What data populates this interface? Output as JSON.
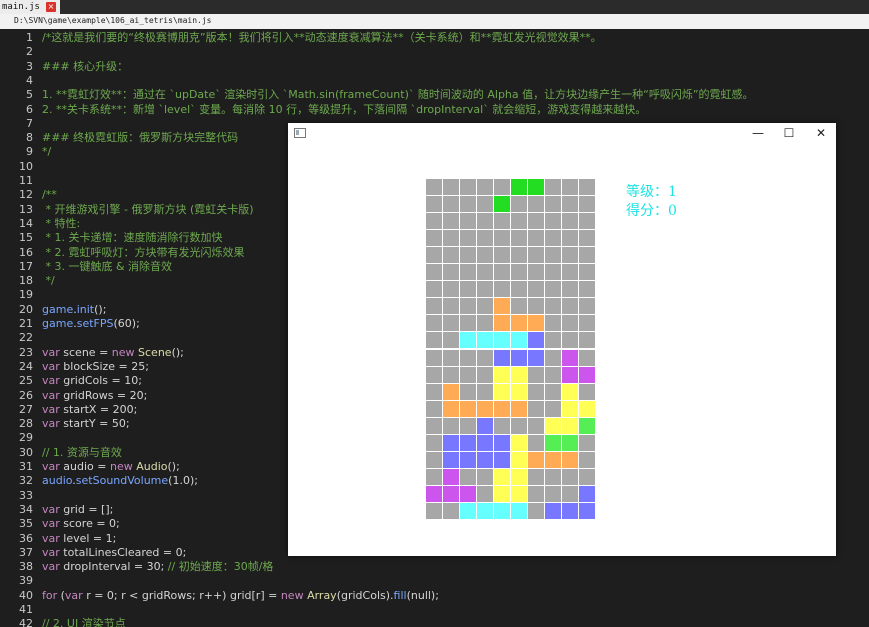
{
  "tab": {
    "filename": "main.js",
    "close_glyph": "×"
  },
  "path": "D:\\SVN\\game\\example\\106_ai_tetris\\main.js",
  "editor": {
    "lines": [
      {
        "n": "1",
        "segs": [
          {
            "t": "/*这就是我们要的“终极赛博朋克”版本！我们将引入**动态速度衰减算法**（关卡系统）和**霓虹发光视觉效果**。",
            "c": "comment"
          }
        ]
      },
      {
        "n": "2",
        "segs": []
      },
      {
        "n": "3",
        "segs": [
          {
            "t": "### 核心升级：",
            "c": "comment"
          }
        ]
      },
      {
        "n": "4",
        "segs": []
      },
      {
        "n": "5",
        "segs": [
          {
            "t": "1. **霓虹灯效**：通过在 `upDate` 渲染时引入 `Math.sin(frameCount)` 随时间波动的 Alpha 值，让方块边缘产生一种“呼吸闪烁”的霓虹感。",
            "c": "comment"
          }
        ]
      },
      {
        "n": "6",
        "segs": [
          {
            "t": "2. **关卡系统**：新增 `level` 变量。每消除 10 行，等级提升，下落间隔 `dropInterval` 就会缩短，游戏变得越来越快。",
            "c": "comment"
          }
        ]
      },
      {
        "n": "7",
        "segs": []
      },
      {
        "n": "8",
        "segs": [
          {
            "t": "### 终极霓虹版：俄罗斯方块完整代码",
            "c": "comment"
          }
        ]
      },
      {
        "n": "9",
        "segs": [
          {
            "t": "*/",
            "c": "comment"
          }
        ]
      },
      {
        "n": "10",
        "segs": []
      },
      {
        "n": "11",
        "segs": []
      },
      {
        "n": "12",
        "segs": [
          {
            "t": "/**",
            "c": "comment"
          }
        ]
      },
      {
        "n": "13",
        "segs": [
          {
            "t": " * 开维游戏引擎 - 俄罗斯方块 (霓虹关卡版)",
            "c": "comment"
          }
        ]
      },
      {
        "n": "14",
        "segs": [
          {
            "t": " * 特性:",
            "c": "comment"
          }
        ]
      },
      {
        "n": "15",
        "segs": [
          {
            "t": " * 1. 关卡递增：速度随消除行数加快",
            "c": "comment"
          }
        ]
      },
      {
        "n": "16",
        "segs": [
          {
            "t": " * 2. 霓虹呼吸灯：方块带有发光闪烁效果",
            "c": "comment"
          }
        ]
      },
      {
        "n": "17",
        "segs": [
          {
            "t": " * 3. 一键触底 & 消除音效",
            "c": "comment"
          }
        ]
      },
      {
        "n": "18",
        "segs": [
          {
            "t": " */",
            "c": "comment"
          }
        ]
      },
      {
        "n": "19",
        "segs": []
      },
      {
        "n": "20",
        "segs": [
          {
            "t": "game",
            "c": "ident"
          },
          {
            "t": ".",
            "c": "plain"
          },
          {
            "t": "init",
            "c": "ident"
          },
          {
            "t": "();",
            "c": "plain"
          }
        ]
      },
      {
        "n": "21",
        "segs": [
          {
            "t": "game",
            "c": "ident"
          },
          {
            "t": ".",
            "c": "plain"
          },
          {
            "t": "setFPS",
            "c": "ident"
          },
          {
            "t": "(60);",
            "c": "plain"
          }
        ]
      },
      {
        "n": "22",
        "segs": []
      },
      {
        "n": "23",
        "segs": [
          {
            "t": "var ",
            "c": "kw"
          },
          {
            "t": "scene = ",
            "c": "plain"
          },
          {
            "t": "new ",
            "c": "kw"
          },
          {
            "t": "Scene",
            "c": "fn"
          },
          {
            "t": "();",
            "c": "plain"
          }
        ]
      },
      {
        "n": "24",
        "segs": [
          {
            "t": "var ",
            "c": "kw"
          },
          {
            "t": "blockSize = 25;",
            "c": "plain"
          }
        ]
      },
      {
        "n": "25",
        "segs": [
          {
            "t": "var ",
            "c": "kw"
          },
          {
            "t": "gridCols = 10;",
            "c": "plain"
          }
        ]
      },
      {
        "n": "26",
        "segs": [
          {
            "t": "var ",
            "c": "kw"
          },
          {
            "t": "gridRows = 20;",
            "c": "plain"
          }
        ]
      },
      {
        "n": "27",
        "segs": [
          {
            "t": "var ",
            "c": "kw"
          },
          {
            "t": "startX = 200;",
            "c": "plain"
          }
        ]
      },
      {
        "n": "28",
        "segs": [
          {
            "t": "var ",
            "c": "kw"
          },
          {
            "t": "startY = 50;",
            "c": "plain"
          }
        ]
      },
      {
        "n": "29",
        "segs": []
      },
      {
        "n": "30",
        "segs": [
          {
            "t": "// 1. 资源与音效",
            "c": "comment"
          }
        ]
      },
      {
        "n": "31",
        "segs": [
          {
            "t": "var ",
            "c": "kw"
          },
          {
            "t": "audio = ",
            "c": "plain"
          },
          {
            "t": "new ",
            "c": "kw"
          },
          {
            "t": "Audio",
            "c": "fn"
          },
          {
            "t": "();",
            "c": "plain"
          }
        ]
      },
      {
        "n": "32",
        "segs": [
          {
            "t": "audio",
            "c": "ident"
          },
          {
            "t": ".",
            "c": "plain"
          },
          {
            "t": "setSoundVolume",
            "c": "ident"
          },
          {
            "t": "(1.0);",
            "c": "plain"
          }
        ]
      },
      {
        "n": "33",
        "segs": []
      },
      {
        "n": "34",
        "segs": [
          {
            "t": "var ",
            "c": "kw"
          },
          {
            "t": "grid = [];",
            "c": "plain"
          }
        ]
      },
      {
        "n": "35",
        "segs": [
          {
            "t": "var ",
            "c": "kw"
          },
          {
            "t": "score = 0;",
            "c": "plain"
          }
        ]
      },
      {
        "n": "36",
        "segs": [
          {
            "t": "var ",
            "c": "kw"
          },
          {
            "t": "level = 1;",
            "c": "plain"
          }
        ]
      },
      {
        "n": "37",
        "segs": [
          {
            "t": "var ",
            "c": "kw"
          },
          {
            "t": "totalLinesCleared = 0;",
            "c": "plain"
          }
        ]
      },
      {
        "n": "38",
        "segs": [
          {
            "t": "var ",
            "c": "kw"
          },
          {
            "t": "dropInterval = 30; ",
            "c": "plain"
          },
          {
            "t": "// 初始速度：30帧/格",
            "c": "comment"
          }
        ]
      },
      {
        "n": "39",
        "segs": []
      },
      {
        "n": "40",
        "segs": [
          {
            "t": "for ",
            "c": "kw"
          },
          {
            "t": "(",
            "c": "plain"
          },
          {
            "t": "var ",
            "c": "kw"
          },
          {
            "t": "r = 0; r < gridRows; r++) grid[r] = ",
            "c": "plain"
          },
          {
            "t": "new ",
            "c": "kw"
          },
          {
            "t": "Array",
            "c": "fn"
          },
          {
            "t": "(gridCols).",
            "c": "plain"
          },
          {
            "t": "fill",
            "c": "ident"
          },
          {
            "t": "(null);",
            "c": "plain"
          }
        ]
      },
      {
        "n": "41",
        "segs": []
      },
      {
        "n": "42",
        "segs": [
          {
            "t": "// 2. UI 渲染节点",
            "c": "comment"
          }
        ]
      }
    ]
  },
  "game_window": {
    "min_glyph": "—",
    "max_glyph": "☐",
    "close_glyph": "✕",
    "hud_level": "等级：1",
    "hud_score": "得分：0",
    "grid_cols": 10,
    "grid_rows": 20,
    "palette": {
      "empty": "#a7a7a7",
      "G": "#22dd22",
      "O": "#ffaa55",
      "C": "#66ffff",
      "B": "#7777ff",
      "P": "#cc55ee",
      "Y": "#ffff55",
      "L": "#55ee55"
    },
    "board": [
      "     GG   ",
      "    G     ",
      "          ",
      "          ",
      "          ",
      "          ",
      "          ",
      "    O     ",
      "    OOO   ",
      "  CCCCB   ",
      "    BBB P ",
      "    YY  PP",
      " O  YY  Y ",
      " OOOOO  YY",
      "   B   YYL",
      " BBBBY LL ",
      " BBBBYOOO ",
      " P  YY    ",
      "PPP YY   B",
      "  CCCC BBB"
    ]
  }
}
